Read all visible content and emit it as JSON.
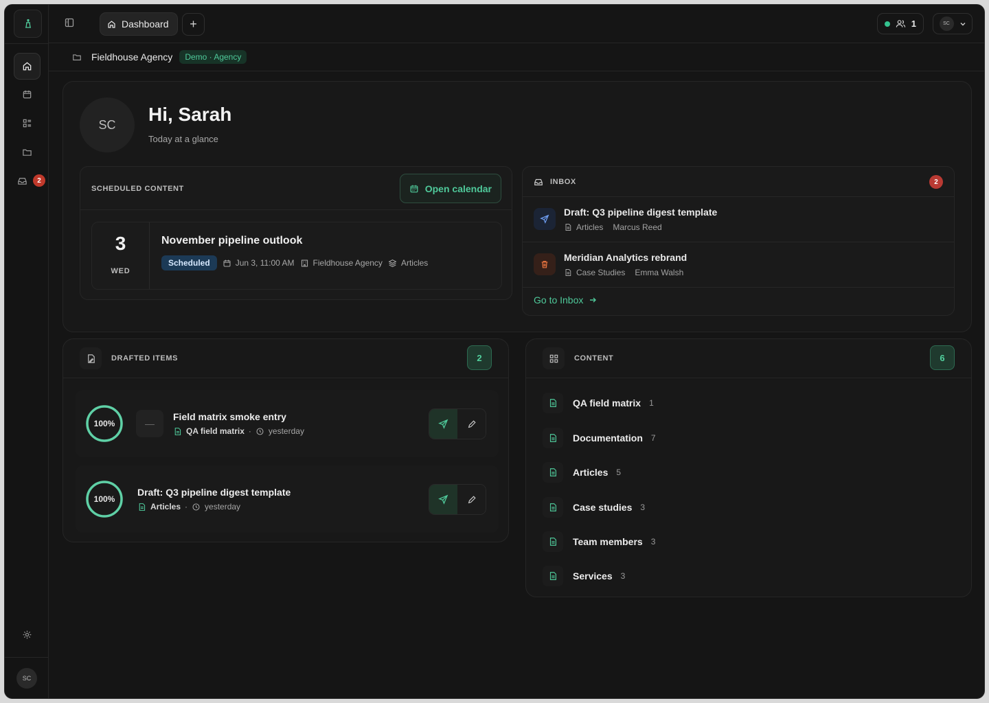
{
  "topbar": {
    "tab_label": "Dashboard",
    "presence_count": "1",
    "user_initials": "SC"
  },
  "rail": {
    "inbox_badge": "2",
    "user_initials": "SC"
  },
  "breadcrumb": {
    "title": "Fieldhouse Agency",
    "badge": "Demo · Agency"
  },
  "hero": {
    "initials": "SC",
    "greeting": "Hi, Sarah",
    "subtitle": "Today at a glance"
  },
  "scheduled": {
    "heading": "SCHEDULED CONTENT",
    "open_calendar": "Open calendar",
    "event": {
      "day": "3",
      "weekday": "WED",
      "title": "November pipeline outlook",
      "status": "Scheduled",
      "datetime": "Jun 3, 11:00 AM",
      "agency": "Fieldhouse Agency",
      "collection": "Articles"
    }
  },
  "inbox": {
    "heading": "INBOX",
    "badge": "2",
    "items": [
      {
        "title": "Draft: Q3 pipeline digest template",
        "collection": "Articles",
        "author": "Marcus Reed"
      },
      {
        "title": "Meridian Analytics rebrand",
        "collection": "Case Studies",
        "author": "Emma Walsh"
      }
    ],
    "link": "Go to Inbox"
  },
  "drafted": {
    "heading": "DRAFTED ITEMS",
    "count": "2",
    "items": [
      {
        "progress": 1.0,
        "progress_label": "100%",
        "thumb": "—",
        "title": "Field matrix smoke entry",
        "collection": "QA field matrix",
        "time": "yesterday"
      },
      {
        "progress": 1.0,
        "progress_label": "100%",
        "title": "Draft: Q3 pipeline digest template",
        "collection": "Articles",
        "time": "yesterday"
      }
    ]
  },
  "content": {
    "heading": "CONTENT",
    "count": "6",
    "items": [
      {
        "label": "QA field matrix",
        "count": "1"
      },
      {
        "label": "Documentation",
        "count": "7"
      },
      {
        "label": "Articles",
        "count": "5"
      },
      {
        "label": "Case studies",
        "count": "3"
      },
      {
        "label": "Team members",
        "count": "3"
      },
      {
        "label": "Services",
        "count": "3"
      }
    ]
  },
  "colors": {
    "accent": "#4fc99a",
    "background": "#151515",
    "danger": "#b93a33",
    "scheduled_badge": "#1c3a56"
  }
}
